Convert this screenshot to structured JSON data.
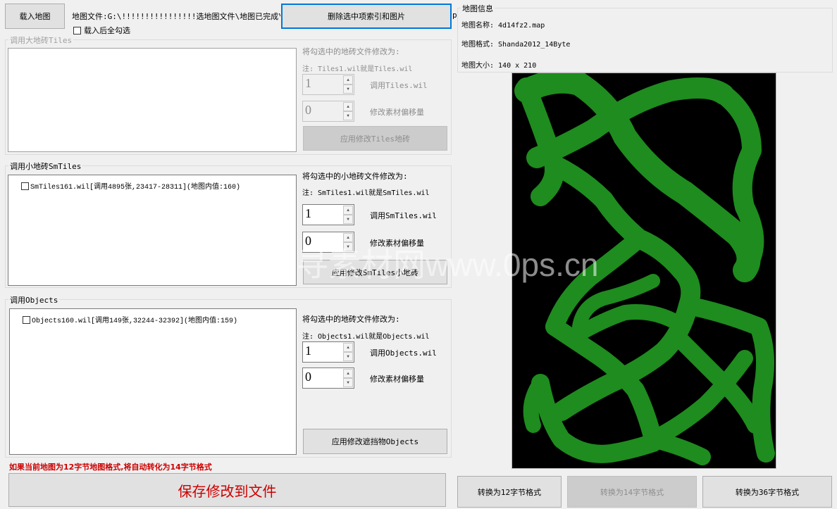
{
  "top": {
    "load_map_label": "载入地图",
    "map_file_text": "地图文件:G:\\!!!!!!!!!!!!!!!!选地图文件\\地图已完成\\",
    "map_file_overflow": "p",
    "select_all_on_load_label": "载入后全勾选",
    "delete_selected_label": "删除选中项索引和图片"
  },
  "tiles": {
    "title": "调用大地砖Tiles",
    "change_to_label": "将勾选中的地砖文件修改为:",
    "note": "注: Tiles1.wil就是Tiles.wil",
    "file_value": "1",
    "file_label": "调用Tiles.wil",
    "offset_value": "0",
    "offset_label": "修改素材偏移量",
    "apply_label": "应用修改Tiles地砖"
  },
  "smtiles": {
    "title": "调用小地砖SmTiles",
    "items": [
      "SmTiles161.wil[调用4895张,23417-28311](地图内值:160)"
    ],
    "change_to_label": "将勾选中的小地砖文件修改为:",
    "note": "注: SmTiles1.wil就是SmTiles.wil",
    "file_value": "1",
    "file_label": "调用SmTiles.wil",
    "offset_value": "0",
    "offset_label": "修改素材偏移量",
    "apply_label": "应用修改SmTiles小地砖"
  },
  "objects": {
    "title": "调用Objects",
    "items": [
      "Objects160.wil[调用149张,32244-32392](地图内值:159)"
    ],
    "change_to_label": "将勾选中的地砖文件修改为:",
    "note": "注: Objects1.wil就是Objects.wil",
    "file_value": "1",
    "file_label": "调用Objects.wil",
    "offset_value": "0",
    "offset_label": "修改素材偏移量",
    "apply_label": "应用修改遮挡物Objects"
  },
  "bottom": {
    "warning": "如果当前地图为12字节地图格式,将自动转化为14字节格式",
    "save_label": "保存修改到文件",
    "to12_label": "转换为12字节格式",
    "to14_label": "转换为14字节格式",
    "to36_label": "转换为36字节格式"
  },
  "map_info": {
    "title": "地图信息",
    "name_line": "地图名称: 4d14fz2.map",
    "format_line": "地图格式: Shanda2012_14Byte",
    "size_line": "地图大小: 140 x 210"
  },
  "watermark": "寻素材网www.0ps.cn",
  "colors": {
    "map_green": "#1e8c1e",
    "map_bg": "#000000",
    "accent": "#0078d7",
    "warning": "#cc0000"
  }
}
